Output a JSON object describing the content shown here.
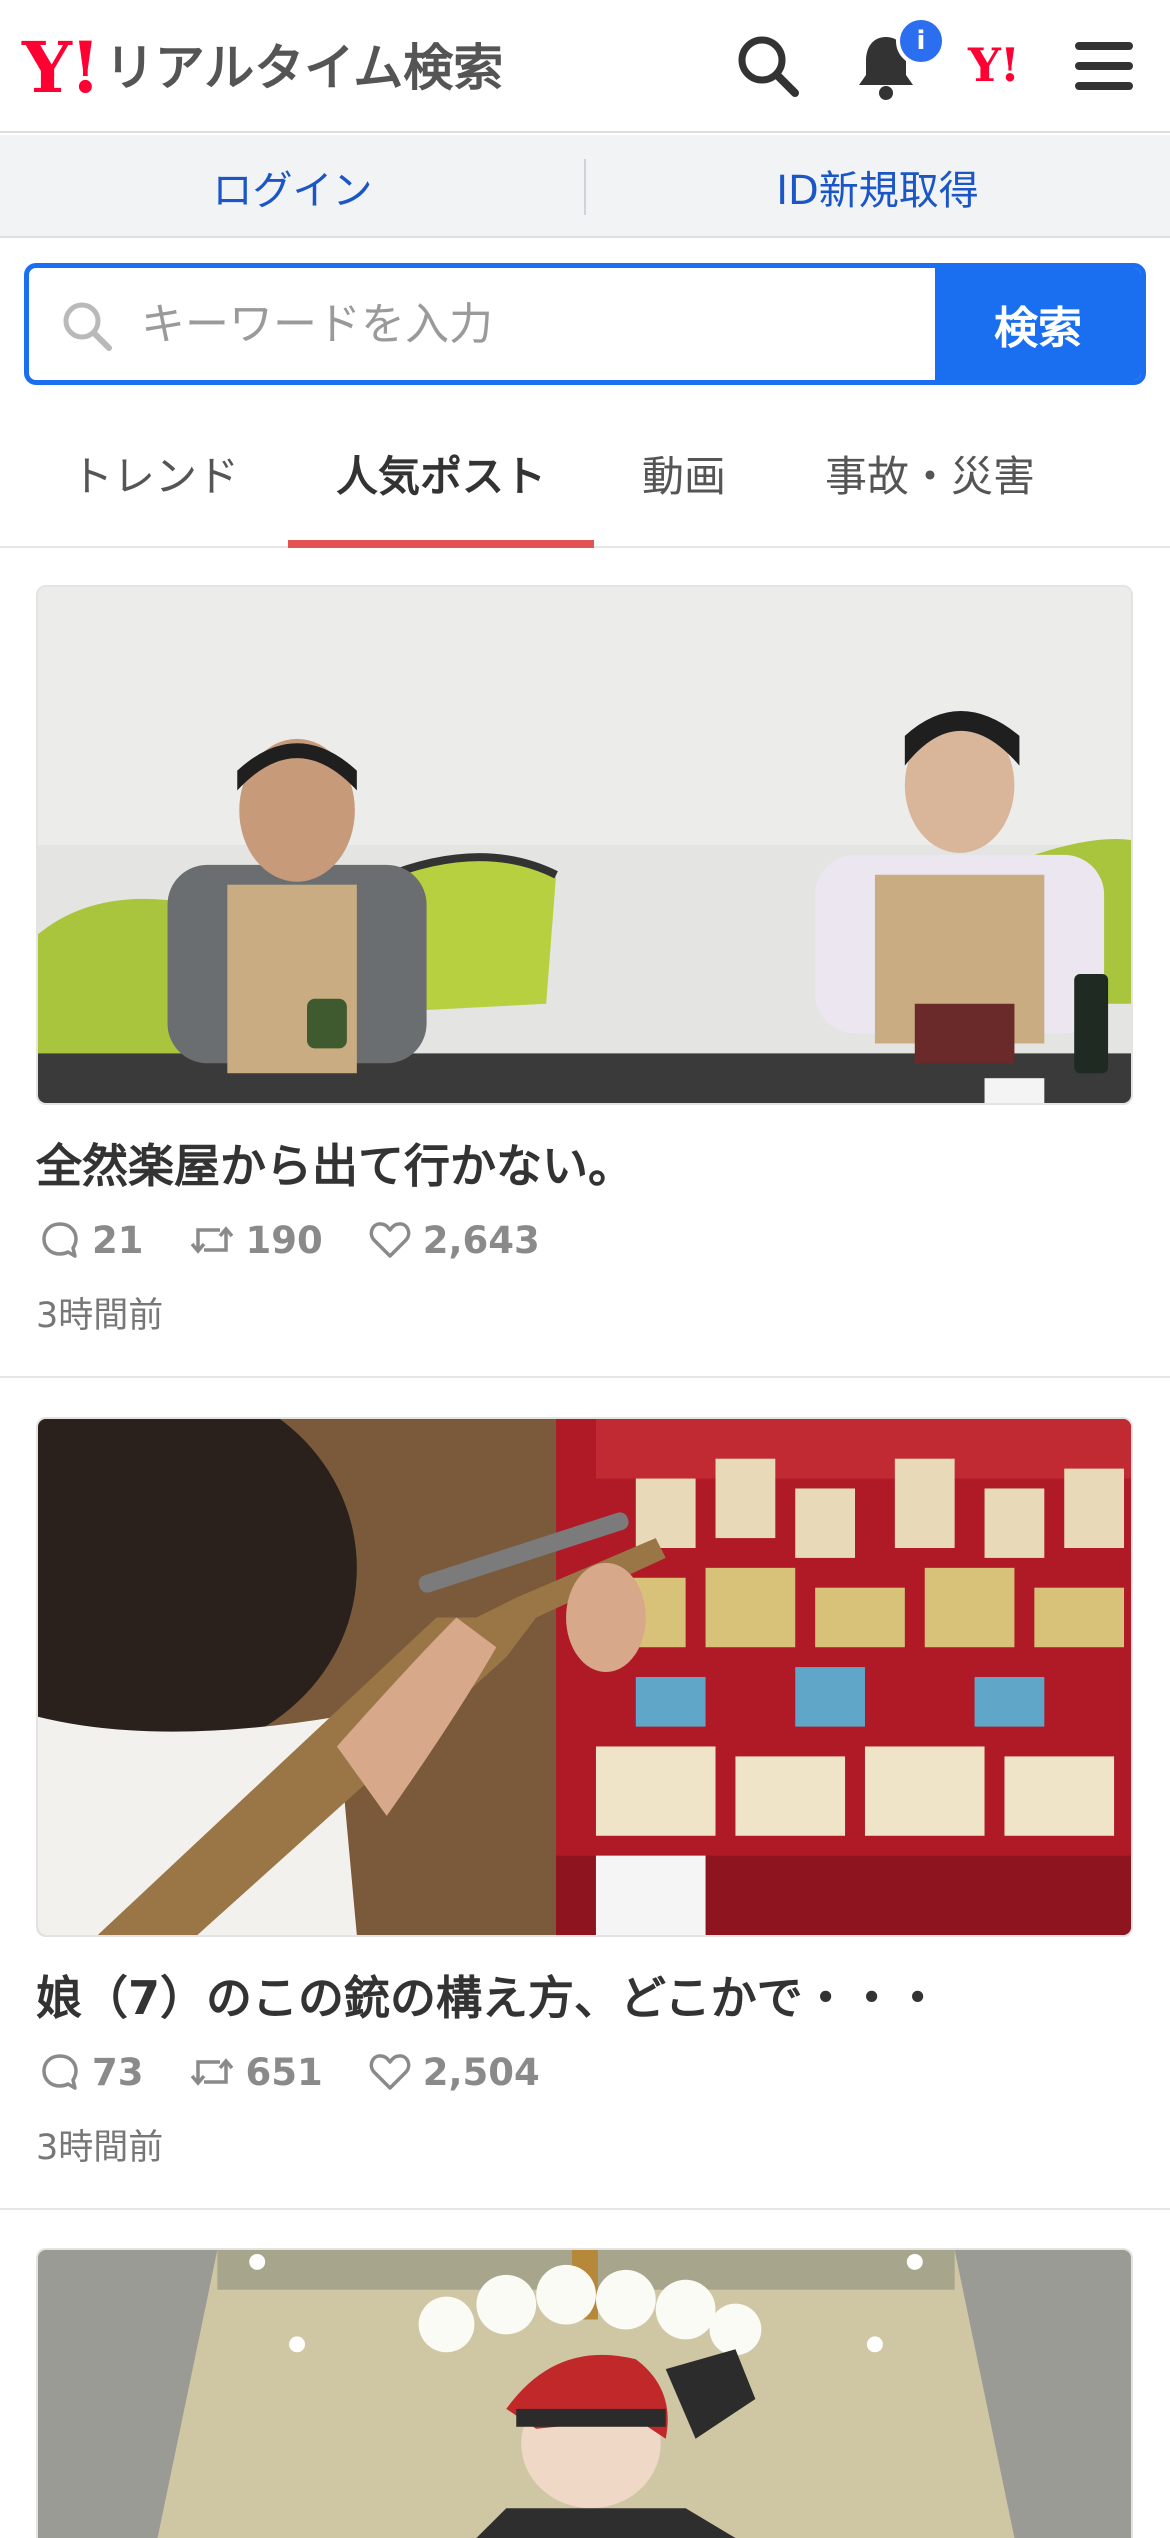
{
  "header": {
    "logo_y": "Y!",
    "logo_text": "リアルタイム検索",
    "badge": "i",
    "yahoo_mini": "Y!"
  },
  "login_bar": {
    "login": "ログイン",
    "register": "ID新規取得"
  },
  "search": {
    "placeholder": "キーワードを入力",
    "value": "",
    "button": "検索"
  },
  "tabs": [
    {
      "label": "トレンド",
      "active": false
    },
    {
      "label": "人気ポスト",
      "active": true
    },
    {
      "label": "動画",
      "active": false
    },
    {
      "label": "事故・災害",
      "active": false
    }
  ],
  "posts": [
    {
      "title": "全然楽屋から出て行かない。",
      "replies": "21",
      "reposts": "190",
      "likes": "2,643",
      "time": "3時間前"
    },
    {
      "title": "娘（7）のこの銃の構え方、どこかで・・・",
      "replies": "73",
      "reposts": "651",
      "likes": "2,504",
      "time": "3時間前"
    },
    {
      "title": "",
      "replies": "",
      "reposts": "",
      "likes": "",
      "time": ""
    }
  ],
  "colors": {
    "brand_red": "#ff0033",
    "accent_blue": "#1a6ff0",
    "link_blue": "#1a56c7",
    "tab_indicator": "#e25454",
    "stat_gray": "#8a8a8a"
  },
  "icons": {
    "header": [
      "search-icon",
      "bell-icon",
      "menu-icon"
    ],
    "stats": [
      "reply-icon",
      "repost-icon",
      "like-icon"
    ]
  }
}
